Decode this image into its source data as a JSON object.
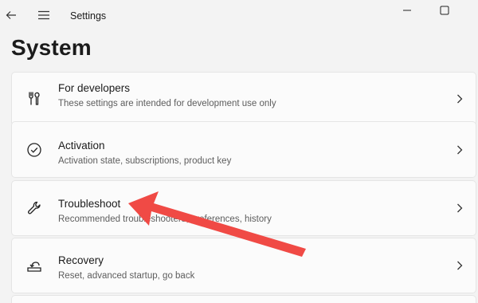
{
  "window": {
    "app_title": "Settings",
    "icons": {
      "back": "back-arrow-icon",
      "menu": "hamburger-menu-icon",
      "minimize": "minimize-icon",
      "maximize": "maximize-icon"
    }
  },
  "page": {
    "title": "System"
  },
  "items": [
    {
      "title": "For developers",
      "desc": "These settings are intended for development use only",
      "icon": "developer-tools-icon"
    },
    {
      "title": "Activation",
      "desc": "Activation state, subscriptions, product key",
      "icon": "check-circle-icon"
    },
    {
      "title": "Troubleshoot",
      "desc": "Recommended troubleshooters, preferences, history",
      "icon": "wrench-icon"
    },
    {
      "title": "Recovery",
      "desc": "Reset, advanced startup, go back",
      "icon": "recovery-icon"
    }
  ],
  "annotation": {
    "color": "#f04a45",
    "icon": "red-annotation-arrow"
  }
}
